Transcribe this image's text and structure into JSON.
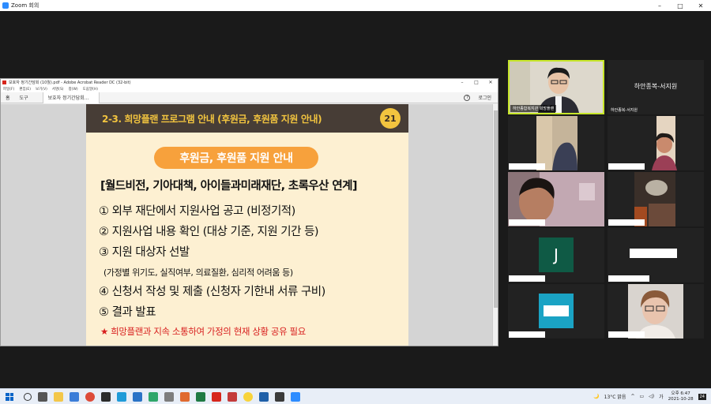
{
  "zoom": {
    "title": "Zoom 회의",
    "window_buttons": [
      "–",
      "□",
      "✕"
    ]
  },
  "acrobat": {
    "title": "보호자 정기간담회 (10월).pdf - Adobe Acrobat Reader DC (32-bit)",
    "window_buttons": [
      "–",
      "□",
      "✕"
    ],
    "menu": [
      "파일(F)",
      "편집(E)",
      "보기(V)",
      "서명(S)",
      "창(W)",
      "도움말(H)"
    ],
    "tabs": {
      "home": "홈",
      "tools": "도구",
      "doc": "보호자 정기간담회...",
      "login": "로그인"
    }
  },
  "slide": {
    "title": "2-3. 희망플랜 프로그램 안내 (후원금, 후원품 지원 안내)",
    "page_number": "21",
    "pill": "후원금, 후원품 지원 안내",
    "orgs": "[월드비전, 기아대책, 아이들과미래재단, 초록우산 연계]",
    "steps": [
      "① 외부 재단에서 지원사업 공고 (비정기적)",
      "② 지원사업 내용 확인 (대상 기준, 지원 기간 등)",
      "③ 지원 대상자 선발",
      "④ 신청서 작성 및 제출 (신청자 기한내 서류 구비)",
      "⑤ 결과 발표"
    ],
    "sub_step": "(가정별 위기도, 실직여부, 의료질환, 심리적 어려움 등)",
    "note": "★ 희망플랜과 지속 소통하여 가정의 현재 상황 공유 필요"
  },
  "gallery": [
    {
      "name": "하안종합복지관 희망플랜",
      "type": "video",
      "active": true
    },
    {
      "name": "하안종복-서지원",
      "center_name": "하안종복-서지원",
      "type": "name"
    },
    {
      "name": "",
      "type": "video"
    },
    {
      "name": "",
      "type": "video"
    },
    {
      "name": "",
      "type": "video"
    },
    {
      "name": "",
      "type": "video"
    },
    {
      "name": "",
      "type": "avatar",
      "initial": "J",
      "color": "#0f5a45"
    },
    {
      "name": "",
      "type": "blank"
    },
    {
      "name": "",
      "type": "avatar-box",
      "color": "#1aa3c4"
    },
    {
      "name": "",
      "type": "video"
    }
  ],
  "taskbar": {
    "weather": "13°C 맑음",
    "time": "오후 6:47",
    "date": "2021-10-28",
    "notifications": "24"
  }
}
